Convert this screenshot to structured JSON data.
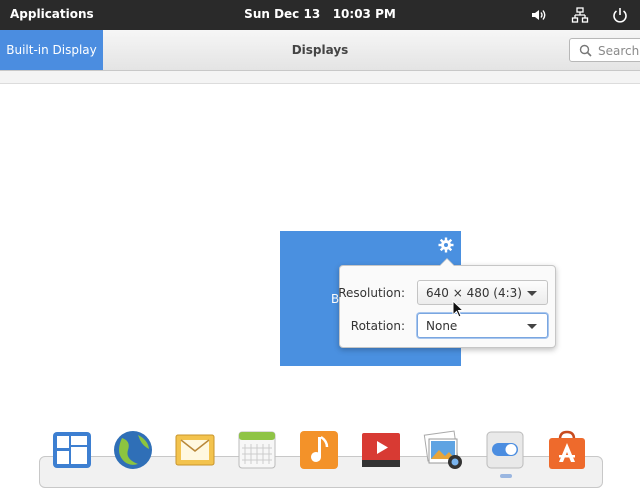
{
  "topbar": {
    "applications_label": "Applications",
    "clock": "Sun Dec 13   10:03 PM",
    "indicators": [
      "volume-icon",
      "network-icon",
      "power-icon"
    ]
  },
  "header": {
    "sidebar_tab_label": "Built-in Display",
    "title": "Displays",
    "search_placeholder": "Search"
  },
  "monitor": {
    "label": "B",
    "settings_icon": "gear-icon"
  },
  "popover": {
    "resolution_label": "Resolution:",
    "resolution_value": "640 × 480 (4:3)",
    "rotation_label": "Rotation:",
    "rotation_value": "None"
  },
  "dock": {
    "apps": [
      "multitasking-view-icon",
      "web-browser-icon",
      "mail-icon",
      "calendar-icon",
      "music-icon",
      "videos-icon",
      "photos-icon",
      "system-settings-icon",
      "appcenter-icon"
    ]
  },
  "colors": {
    "accent": "#4b8de0",
    "topbar": "#2a2a2a",
    "monitor": "#4a90e0"
  }
}
